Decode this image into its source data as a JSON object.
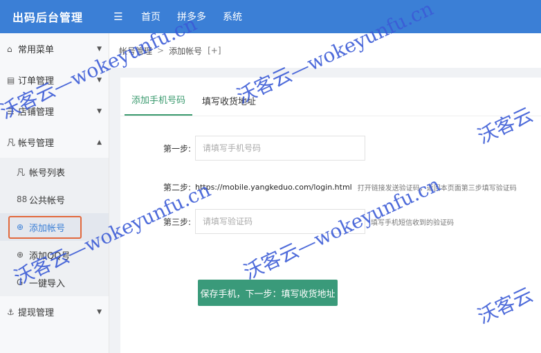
{
  "topbar": {
    "brand": "出码后台管理",
    "menu_icon": "menu-fold-icon",
    "nav": [
      "首页",
      "拼多多",
      "系统"
    ]
  },
  "sidebar": {
    "groups": [
      {
        "icon": "⌂",
        "label": "常用菜单",
        "caret": "▼"
      },
      {
        "icon": "▤",
        "label": "订单管理",
        "caret": "▼"
      },
      {
        "icon": "☰",
        "label": "店铺管理",
        "caret": "▼"
      },
      {
        "icon": "凡",
        "label": "帐号管理",
        "caret": "▲"
      }
    ],
    "sub_items": [
      {
        "icon": "凡",
        "label": "帐号列表"
      },
      {
        "icon": "88",
        "label": "公共帐号"
      },
      {
        "icon": "⊕",
        "label": "添加帐号"
      },
      {
        "icon": "⊕",
        "label": "添加QQ号"
      },
      {
        "icon": "G",
        "label": "一键导入"
      }
    ],
    "last_group": {
      "icon": "⚓",
      "label": "提现管理",
      "caret": "▼"
    }
  },
  "breadcrumb": {
    "parent": "帐号管理",
    "separator": ">",
    "current": "添加帐号",
    "extra": "[+]"
  },
  "tabs": [
    "添加手机号码",
    "填写收货地址"
  ],
  "form": {
    "step1_label": "第一步:",
    "step1_placeholder": "请填写手机号码",
    "step2_label": "第二步:",
    "step2_url": "https://mobile.yangkeduo.com/login.html",
    "step2_hint": "打开链接发送验证码，返回本页面第三步填写验证码",
    "step3_label": "第三步:",
    "step3_placeholder": "请填写验证码",
    "step3_hint": "填写手机短信收到的验证码",
    "submit_label": "保存手机，下一步：填写收货地址"
  },
  "watermark": "沃客云—wokeyunfu.cn",
  "watermark_short": "沃客云"
}
